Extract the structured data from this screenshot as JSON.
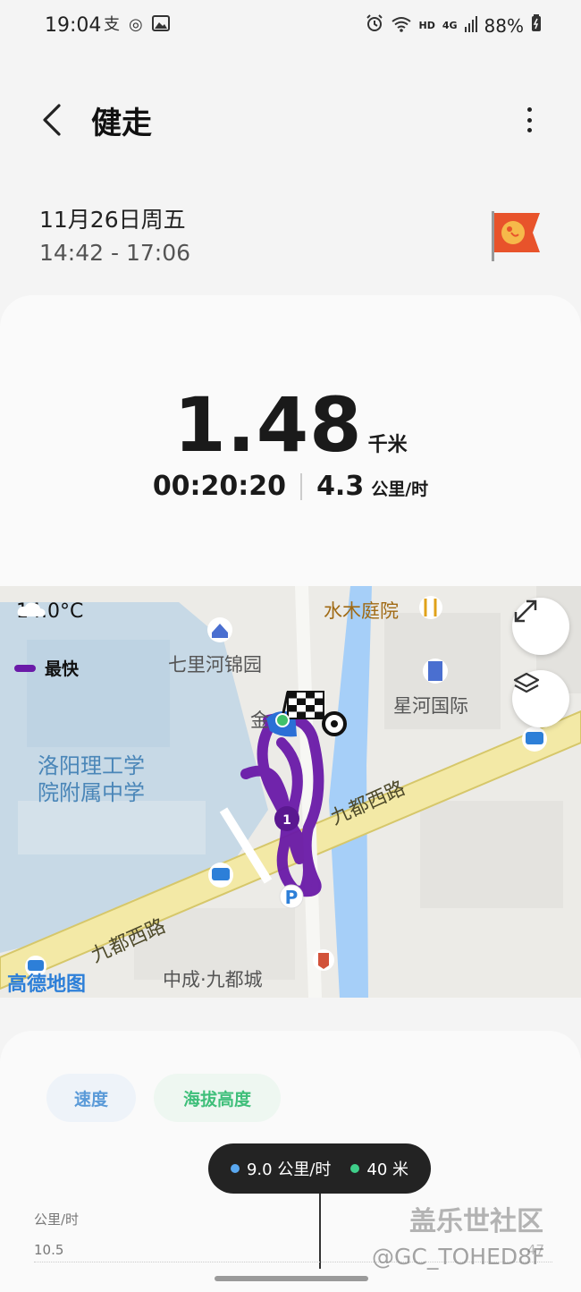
{
  "status_bar": {
    "time": "19:04",
    "battery": "88%",
    "network": "4G",
    "hd": "HD",
    "left_icons": [
      "alipay-icon",
      "sync-icon",
      "gallery-icon"
    ],
    "right_icons": [
      "alarm-icon",
      "wifi-icon",
      "signal-icon",
      "battery-icon"
    ]
  },
  "header": {
    "title": "健走",
    "back_icon": "chevron-left-icon",
    "more_icon": "more-vertical-icon"
  },
  "session": {
    "date": "11月26日周五",
    "time_range": "14:42 - 17:06",
    "badge_icon": "route-flag-icon"
  },
  "summary": {
    "distance": "1.48",
    "distance_unit": "千米",
    "duration": "00:20:20",
    "speed": "4.3",
    "speed_unit": "公里/时"
  },
  "map": {
    "temperature": "14.0°C",
    "legend": "最快",
    "labels": {
      "school": [
        "洛阳理工学",
        "院附属中学"
      ],
      "residential": "七里河锦园",
      "garden": "水木庭院",
      "xinghe": "星河国际",
      "road1": "九都西路",
      "road2": "九都西路",
      "mall": "中成·九都城",
      "partial": "金"
    },
    "provider": "高德地图",
    "expand_icon": "expand-icon",
    "layers_icon": "layers-icon",
    "track_color": "#6a1aa8",
    "river_color": "#a6cff8"
  },
  "chart": {
    "tabs": [
      "速度",
      "海拔高度"
    ],
    "tooltip_speed": "9.0 公里/时",
    "tooltip_alt": "40 米",
    "y_unit": "公里/时",
    "y_tick": "10.5",
    "y_tick_right": "47",
    "speed_color": "#5aa8f0",
    "alt_color": "#3fcf8a"
  },
  "watermark": {
    "line1": "盖乐世社区",
    "line2": "@GC_TOHED8F"
  }
}
